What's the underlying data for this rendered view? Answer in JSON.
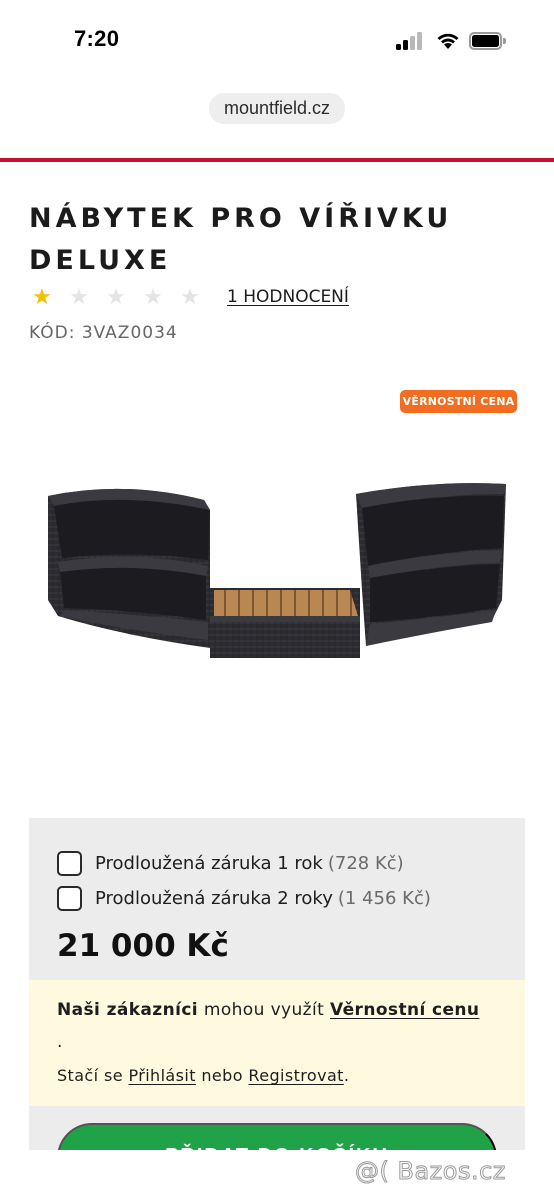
{
  "status_bar": {
    "time": "7:20"
  },
  "browser": {
    "url": "mountfield.cz"
  },
  "product": {
    "title": "NÁBYTEK PRO VÍŘIVKU DELUXE",
    "rating": {
      "value": 1,
      "max": 5,
      "reviews_label": "1 HODNOCENÍ"
    },
    "code": "KÓD: 3VAZ0034",
    "badge": "VĚRNOSTNÍ CENA"
  },
  "options": [
    {
      "label": "Prodloužená záruka 1 rok",
      "price": "(728 Kč)"
    },
    {
      "label": "Prodloužená záruka 2 roky",
      "price": "(1 456 Kč)"
    }
  ],
  "price": "21 000 Kč",
  "loyalty": {
    "bold": "Naši zákazníci",
    "text": "mohou využít",
    "link": "Věrnostní cenu",
    "dot": ".",
    "line2_prefix": "Stačí se",
    "login": "Přihlásit",
    "or": "nebo",
    "register": "Registrovat",
    "line2_suffix": "."
  },
  "cart_button": "PŘIDAT DO KOŠÍKU",
  "watermark": "@( Bazos.cz",
  "colors": {
    "accent_red": "#c8102e",
    "badge_orange": "#f26d1f",
    "cart_green": "#20a248",
    "star_gold": "#f2c200"
  }
}
